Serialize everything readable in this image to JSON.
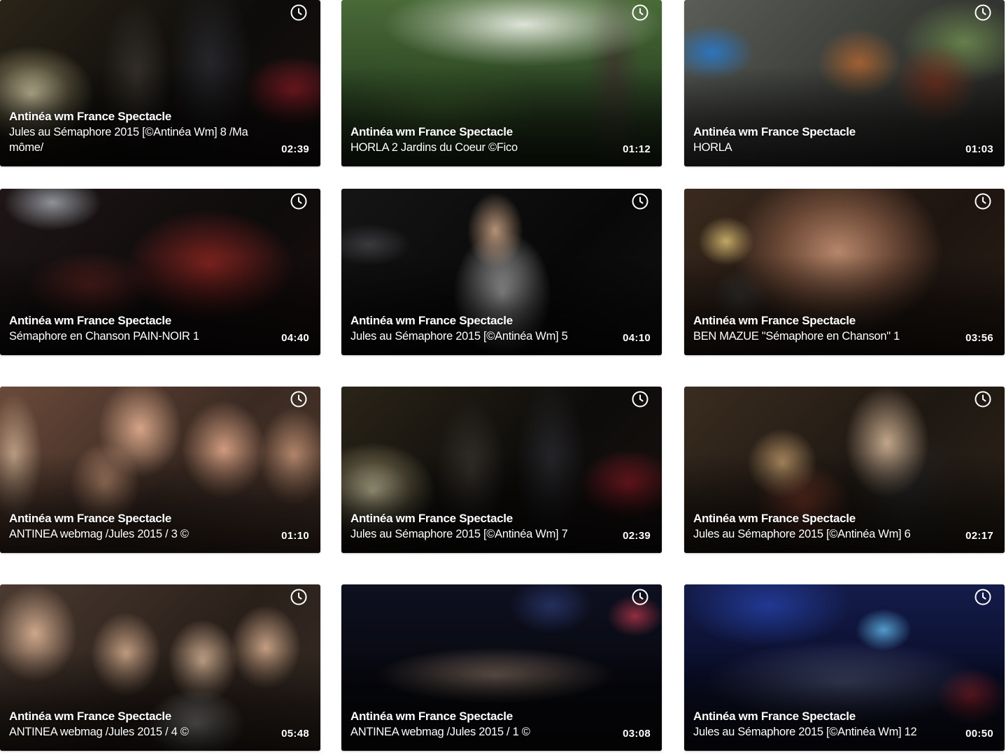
{
  "icons": {
    "duration": "clock-icon"
  },
  "videos": [
    {
      "channel": "Antinéa wm France Spectacle",
      "title": "Jules au Sémaphore 2015 [©Antinéa Wm] 8 /Ma môme/",
      "duration": "02:39"
    },
    {
      "channel": "Antinéa wm France Spectacle",
      "title": "HORLA 2 Jardins du Coeur ©Fico",
      "duration": "01:12"
    },
    {
      "channel": "Antinéa wm France Spectacle",
      "title": "HORLA",
      "duration": "01:03"
    },
    {
      "channel": "Antinéa wm France Spectacle",
      "title": "Sémaphore en Chanson PAIN-NOIR 1",
      "duration": "04:40"
    },
    {
      "channel": "Antinéa wm France Spectacle",
      "title": "Jules au Sémaphore 2015 [©Antinéa Wm] 5",
      "duration": "04:10"
    },
    {
      "channel": "Antinéa wm France Spectacle",
      "title": "BEN MAZUE \"Sémaphore en Chanson\" 1",
      "duration": "03:56"
    },
    {
      "channel": "Antinéa wm France Spectacle",
      "title": "ANTINEA webmag /Jules 2015 / 3 ©",
      "duration": "01:10"
    },
    {
      "channel": "Antinéa wm France Spectacle",
      "title": "Jules au Sémaphore 2015 [©Antinéa Wm] 7",
      "duration": "02:39"
    },
    {
      "channel": "Antinéa wm France Spectacle",
      "title": "Jules au Sémaphore 2015 [©Antinéa Wm] 6",
      "duration": "02:17"
    },
    {
      "channel": "Antinéa wm France Spectacle",
      "title": "ANTINEA webmag /Jules 2015 / 4 ©",
      "duration": "05:48"
    },
    {
      "channel": "Antinéa wm France Spectacle",
      "title": "ANTINEA webmag /Jules 2015 / 1 ©",
      "duration": "03:08"
    },
    {
      "channel": "Antinéa wm France Spectacle",
      "title": "Jules au Sémaphore 2015 [©Antinéa Wm] 12",
      "duration": "00:50"
    }
  ]
}
